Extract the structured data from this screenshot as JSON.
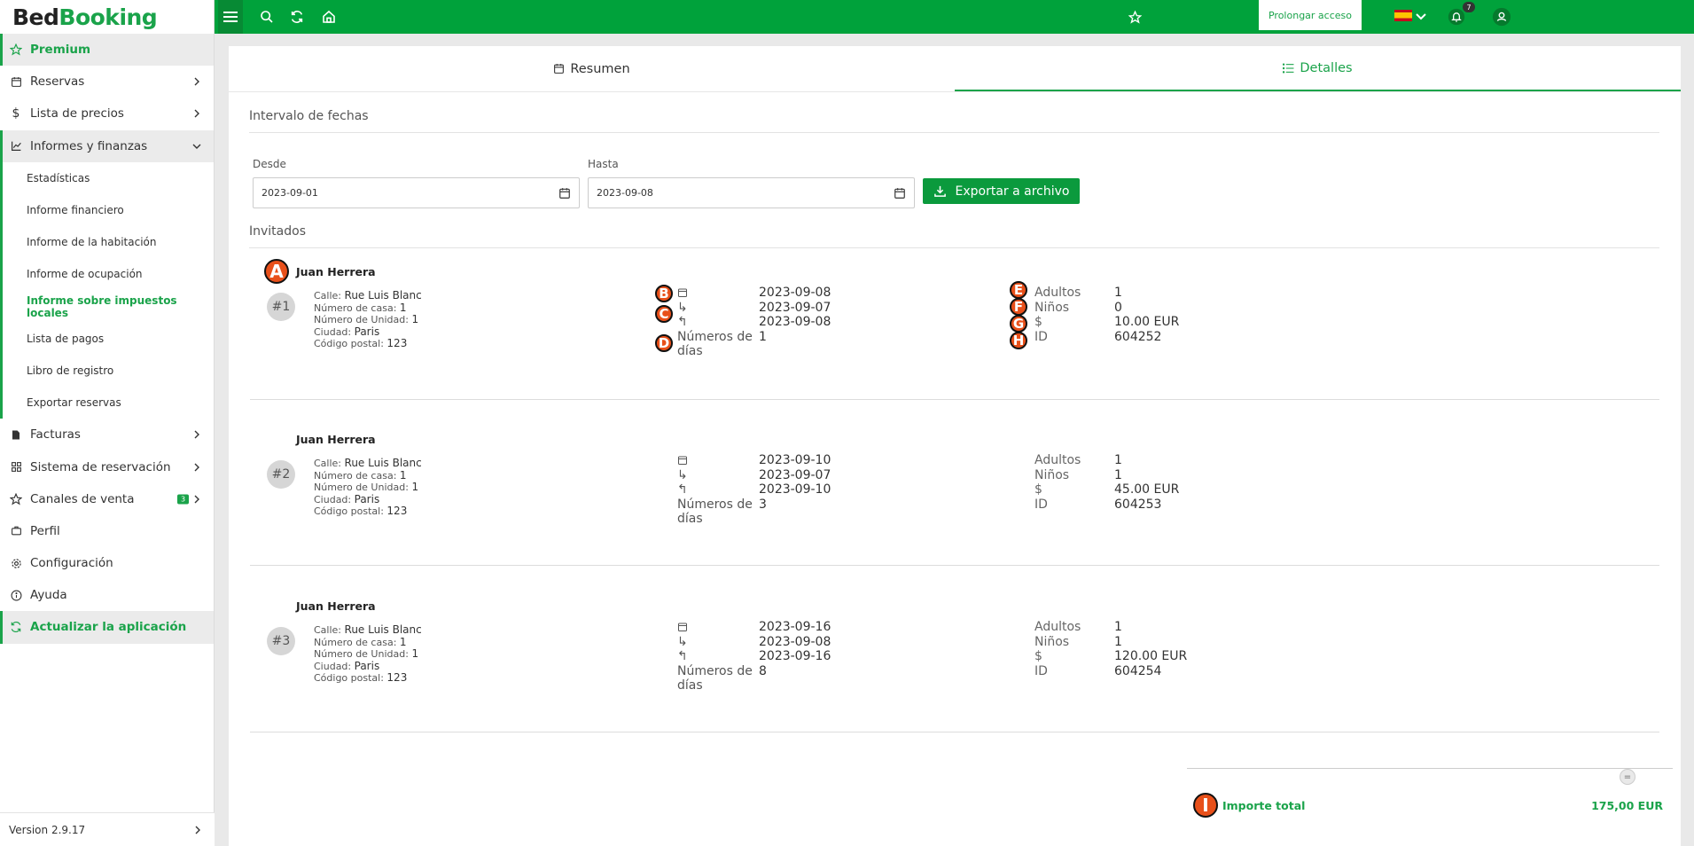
{
  "brand": {
    "part1": "Bed",
    "part2": "Booking"
  },
  "sidebar": {
    "premium": "Premium",
    "items": [
      {
        "label": "Reservas"
      },
      {
        "label": "Lista de precios"
      },
      {
        "label": "Informes y finanzas"
      }
    ],
    "sub_items": [
      {
        "label": "Estadísticas"
      },
      {
        "label": "Informe financiero"
      },
      {
        "label": "Informe de la habitación"
      },
      {
        "label": "Informe de ocupación"
      },
      {
        "label": "Informe sobre impuestos locales"
      },
      {
        "label": "Lista de pagos"
      },
      {
        "label": "Libro de registro"
      },
      {
        "label": "Exportar reservas"
      }
    ],
    "items2": [
      {
        "label": "Facturas"
      },
      {
        "label": "Sistema de reservación",
        "badge": ""
      },
      {
        "label": "Canales de venta",
        "badge": "3"
      },
      {
        "label": "Perfil"
      },
      {
        "label": "Configuración"
      },
      {
        "label": "Ayuda"
      }
    ],
    "update": "Actualizar la aplicación",
    "version": "Version 2.9.17"
  },
  "topbar": {
    "prolongar": "Prolongar acceso",
    "notifications": "7"
  },
  "tabs": {
    "resumen": "Resumen",
    "detalles": "Detalles"
  },
  "filters": {
    "section_title": "Intervalo de fechas",
    "from_label": "Desde",
    "from_value": "2023-09-01",
    "to_label": "Hasta",
    "to_value": "2023-09-08",
    "export_label": "Exportar a archivo"
  },
  "guests_title": "Invitados",
  "address_labels": {
    "street": "Calle:",
    "house": "Número de casa:",
    "unit": "Número de Unidad:",
    "city": "Ciudad:",
    "zip": "Código postal:"
  },
  "detail_labels": {
    "days_line1": "Números de",
    "days_line2": "días",
    "adults": "Adultos",
    "children": "Niños",
    "price": "$",
    "id": "ID"
  },
  "guests": [
    {
      "number": "#1",
      "name": "Juan Herrera",
      "street": "Rue Luis Blanc",
      "house": "1",
      "unit": "1",
      "city": "Paris",
      "zip": "123",
      "date": "2023-09-08",
      "checkin": "2023-09-07",
      "checkout": "2023-09-08",
      "days": "1",
      "adults": "1",
      "children": "0",
      "price": "10.00 EUR",
      "id": "604252"
    },
    {
      "number": "#2",
      "name": "Juan Herrera",
      "street": "Rue Luis Blanc",
      "house": "1",
      "unit": "1",
      "city": "Paris",
      "zip": "123",
      "date": "2023-09-10",
      "checkin": "2023-09-07",
      "checkout": "2023-09-10",
      "days": "3",
      "adults": "1",
      "children": "1",
      "price": "45.00 EUR",
      "id": "604253"
    },
    {
      "number": "#3",
      "name": "Juan Herrera",
      "street": "Rue Luis Blanc",
      "house": "1",
      "unit": "1",
      "city": "Paris",
      "zip": "123",
      "date": "2023-09-16",
      "checkin": "2023-09-08",
      "checkout": "2023-09-16",
      "days": "8",
      "adults": "1",
      "children": "1",
      "price": "120.00 EUR",
      "id": "604254"
    }
  ],
  "markers": [
    "A",
    "B",
    "C",
    "D",
    "E",
    "F",
    "G",
    "H",
    "I"
  ],
  "total": {
    "label": "Importe total",
    "value": "175,00 EUR",
    "eq": "="
  },
  "colors": {
    "accent": "#1aa34a",
    "topbar": "#00a23b",
    "marker": "#e8501a"
  }
}
